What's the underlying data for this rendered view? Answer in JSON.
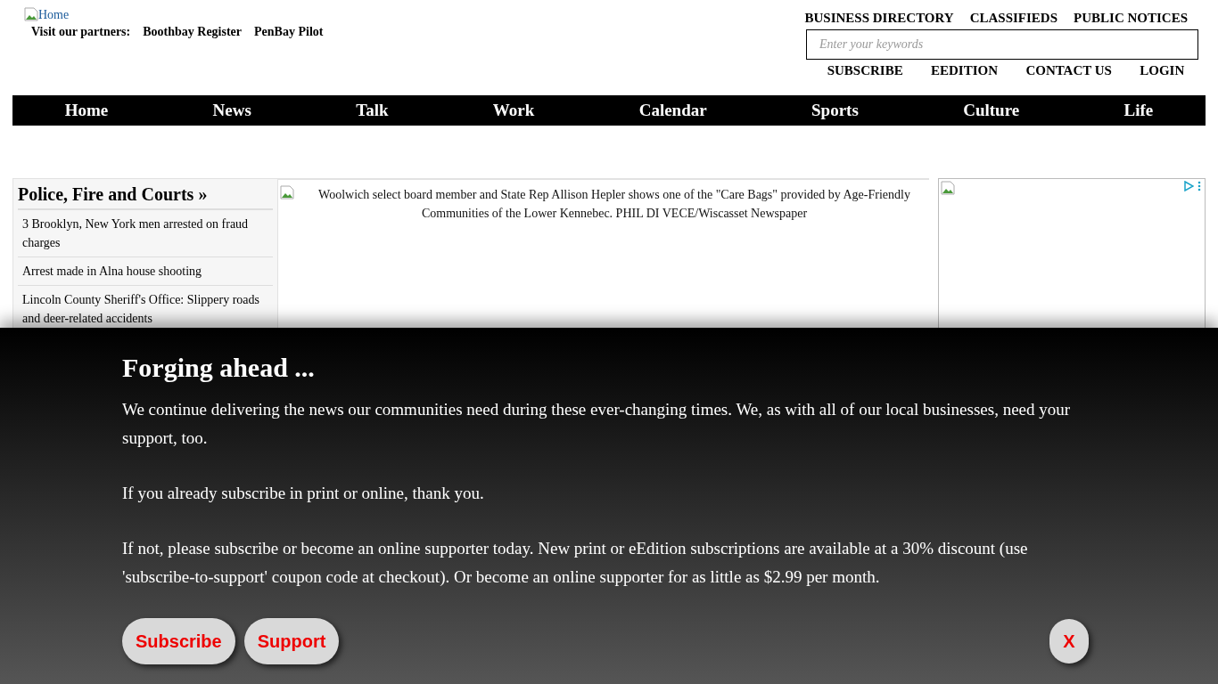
{
  "header": {
    "logo_alt": "Home",
    "partners_label": "Visit our partners:",
    "partners": [
      "Boothbay Register",
      "PenBay Pilot"
    ],
    "top_links": [
      "BUSINESS DIRECTORY",
      "CLASSIFIEDS",
      "PUBLIC NOTICES"
    ],
    "search": {
      "placeholder": "Enter your keywords"
    },
    "account_links": [
      "SUBSCRIBE",
      "EEDITION",
      "CONTACT US",
      "LOGIN"
    ]
  },
  "nav": [
    "Home",
    "News",
    "Talk",
    "Work",
    "Calendar",
    "Sports",
    "Culture",
    "Life"
  ],
  "sidebar": {
    "title": "Police, Fire and Courts »",
    "items": [
      "3 Brooklyn, New York men arrested on fraud charges",
      "Arrest made in Alna house shooting",
      "Lincoln County Sheriff's Office: Slippery roads and deer-related accidents"
    ]
  },
  "feature": {
    "caption": "Woolwich select board member and State Rep Allison Hepler shows one of the \"Care Bags\" provided by Age-Friendly Communities of the Lower Kennebec. PHIL DI VECE/Wiscasset Newspaper"
  },
  "overlay": {
    "title": "Forging ahead ...",
    "paragraphs": [
      "We continue delivering the news our communities need during these ever-changing times. We, as with all of our local businesses, need your support, too.",
      "If you already subscribe in print or online, thank you.",
      "If not, please subscribe or become an online supporter today. New print or eEdition subscriptions are available at a 30% discount (use 'subscribe-to-support' coupon code at checkout). Or become an online supporter for as little as $2.99 per month."
    ],
    "buttons": [
      "Subscribe",
      "Support"
    ],
    "close": "X"
  }
}
